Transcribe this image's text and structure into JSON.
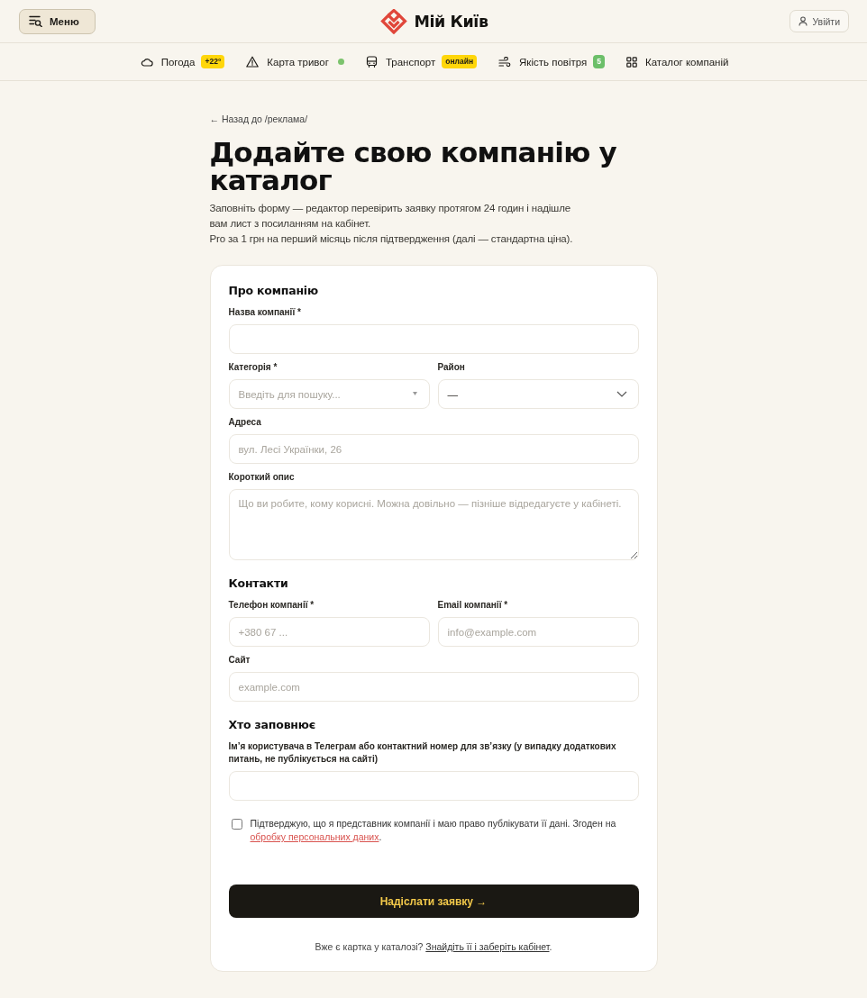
{
  "header": {
    "menu_button": {
      "label": "Меню"
    },
    "logo": {
      "text": "Мій Київ"
    },
    "login_button": {
      "label": "Увійти"
    }
  },
  "nav": {
    "items": [
      {
        "kind": "weather",
        "label": "Погода",
        "badge": {
          "text": "+22°",
          "color": "#ffd60a"
        }
      },
      {
        "kind": "alerts",
        "label": "Карта тривог",
        "dot": {
          "color": "#7cc36d"
        }
      },
      {
        "kind": "transport",
        "label": "Транспорт",
        "badge": {
          "text": "онлайн",
          "color": "#ffd60a"
        }
      },
      {
        "kind": "air",
        "label": "Якість повітря",
        "badge": {
          "text": "5",
          "color": "#6cbf69"
        }
      },
      {
        "kind": "catalog",
        "label": "Каталог компаній"
      }
    ]
  },
  "back_link": "← Назад до /реклама/",
  "title": "Додайте свою компанію у каталог",
  "intro": [
    "Заповніть форму — редактор перевірить заявку протягом 24 годин і надішле вам лист з посиланням на кабінет.",
    "Pro за 1 грн на перший місяць після підтвердження (далі — стандартна ціна)."
  ],
  "form": {
    "sections": [
      {
        "heading": "Про компанію",
        "rows": [
          [
            {
              "kind": "input",
              "label": "Назва компанії *"
            }
          ],
          [
            {
              "kind": "combobox",
              "label": "Категорія *",
              "placeholder": "Введіть для пошуку..."
            },
            {
              "kind": "select",
              "label": "Район",
              "value": "—"
            }
          ],
          [
            {
              "kind": "input",
              "label": "Адреса",
              "placeholder": "вул. Лесі Українки, 26"
            }
          ],
          [
            {
              "kind": "textarea",
              "label": "Короткий опис",
              "placeholder": "Що ви робите, кому корисні. Можна довільно — пізніше відредагуєте у кабінеті."
            }
          ]
        ]
      },
      {
        "heading": "Контакти",
        "rows": [
          [
            {
              "kind": "input",
              "label": "Телефон компанії *",
              "placeholder": "+380 67 ..."
            },
            {
              "kind": "input",
              "label": "Email компанії *",
              "placeholder": "info@example.com"
            }
          ],
          [
            {
              "kind": "input",
              "label": "Сайт",
              "placeholder": "example.com"
            }
          ]
        ]
      },
      {
        "heading": "Хто заповнює",
        "rows": [
          [
            {
              "kind": "input",
              "label": "Ім’я користувача в Телеграм або контактний номер для зв’язку (у випадку додаткових питань, не публікується на сайті)"
            }
          ]
        ]
      }
    ],
    "consent": {
      "checked": false,
      "text": "Підтверджую, що я представник компанії і маю право публікувати її дані. Згоден на",
      "link": "обробку персональних даних",
      "end": "."
    },
    "submit": {
      "label": "Надіслати заявку →"
    },
    "footer": {
      "text": "Вже є картка у каталозі?",
      "link": "Знайдіть її і заберіть кабінет",
      "end": "."
    }
  }
}
